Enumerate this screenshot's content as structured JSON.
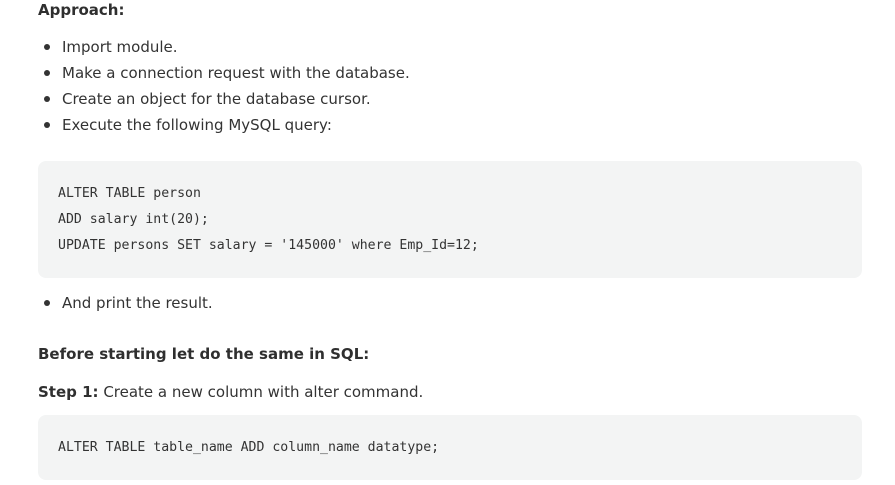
{
  "approach": {
    "heading": "Approach:",
    "steps": [
      "Import module.",
      "Make a connection request with the database.",
      "Create an object for the database cursor.",
      "Execute the following MySQL query:"
    ]
  },
  "query_code": {
    "lines": [
      "ALTER TABLE person",
      "ADD salary int(20);",
      "UPDATE persons SET salary = '145000' where Emp_Id=12;"
    ]
  },
  "final_step": "And print the result.",
  "sql_section": {
    "heading": "Before starting let do the same in SQL:",
    "step1_label": "Step 1:",
    "step1_text": " Create a new column with alter command."
  },
  "alter_code": {
    "lines": [
      "ALTER TABLE table_name ADD column_name datatype;"
    ]
  }
}
